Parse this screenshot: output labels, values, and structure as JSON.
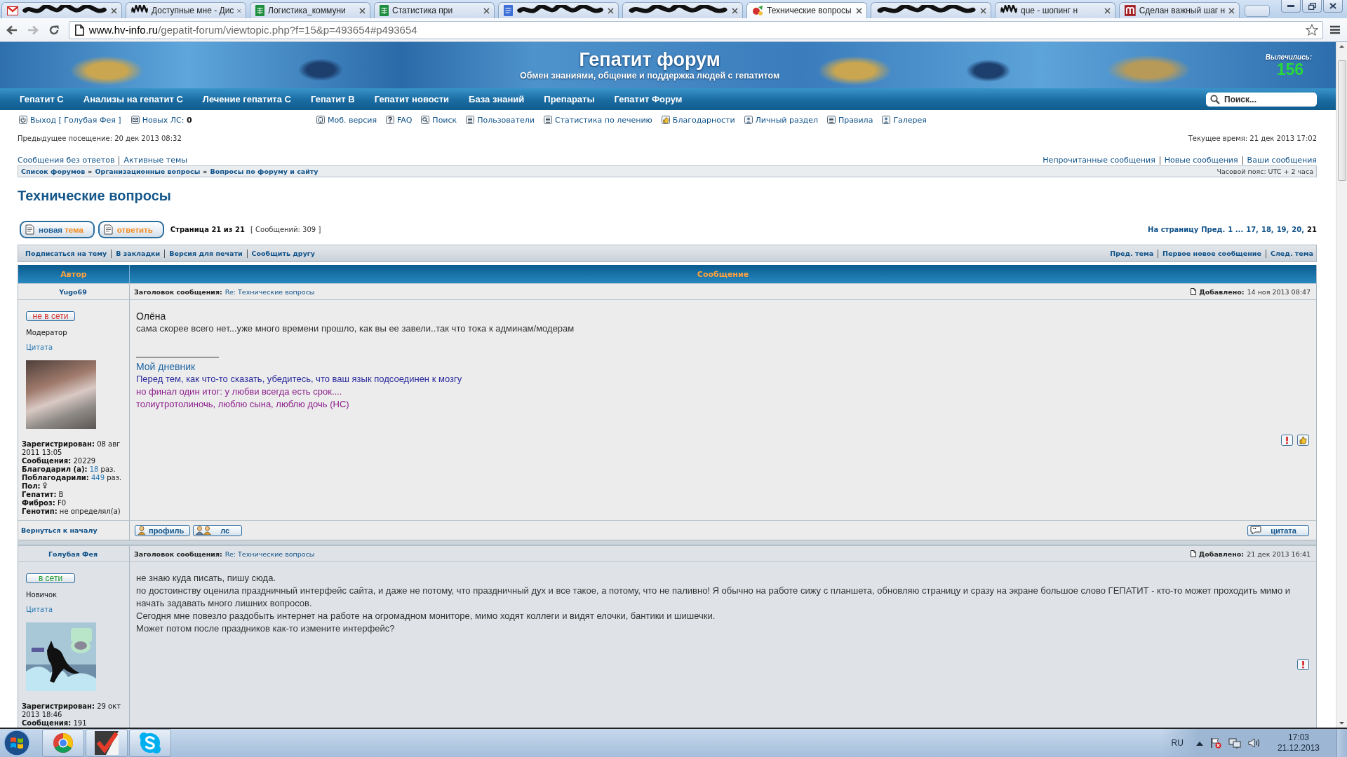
{
  "browser": {
    "tabs": [
      {
        "kind": "mail",
        "redacted": true,
        "selected": false
      },
      {
        "kind": "none",
        "redacted": true,
        "title": "Доступные мне - Дис",
        "selected": false
      },
      {
        "kind": "sheet",
        "redacted": false,
        "title": "Логистика_коммуни",
        "selected": false
      },
      {
        "kind": "sheet",
        "redacted": false,
        "title": "Статистика при",
        "selected": false
      },
      {
        "kind": "doc",
        "redacted": true,
        "selected": false
      },
      {
        "kind": "none",
        "redacted": true,
        "selected": false
      },
      {
        "kind": "forum",
        "redacted": false,
        "title": "Технические вопросы",
        "selected": true
      },
      {
        "kind": "none",
        "redacted": true,
        "selected": false
      },
      {
        "kind": "none",
        "redacted": true,
        "title": "que - шопинг н",
        "selected": false
      },
      {
        "kind": "news",
        "redacted": false,
        "title": "Сделан важный шаг н",
        "selected": false
      }
    ],
    "address": {
      "host": "www.hv-info.ru",
      "path": "/gepatit-forum/viewtopic.php?f=15&p=493654#p493654"
    }
  },
  "banner": {
    "title": "Гепатит форум",
    "subtitle": "Обмен знаниями, общение и поддержка людей с гепатитом",
    "counter_label": "Вылечились:",
    "counter": "156"
  },
  "nav": {
    "items": [
      "Гепатит C",
      "Анализы на гепатит C",
      "Лечение гепатита C",
      "Гепатит B",
      "Гепатит новости",
      "База знаний",
      "Препараты",
      "Гепатит Форум"
    ],
    "search": {
      "placeholder": "Поиск..."
    }
  },
  "user_bar": {
    "left": [
      {
        "kind": "exit",
        "text": "Выход [ Голубая Фея ]"
      },
      {
        "kind": "mail",
        "text": "Новых ЛС: **0**"
      }
    ],
    "right": [
      {
        "kind": "mobile",
        "text": "Моб. версия"
      },
      {
        "kind": "faq",
        "text": "FAQ"
      },
      {
        "kind": "search",
        "text": "Поиск"
      },
      {
        "kind": "list",
        "text": "Пользователи"
      },
      {
        "kind": "list",
        "text": "Статистика по лечению"
      },
      {
        "kind": "thanks",
        "text": "Благодарности"
      },
      {
        "kind": "user",
        "text": "Личный раздел"
      },
      {
        "kind": "list",
        "text": "Правила"
      },
      {
        "kind": "user",
        "text": "Галерея"
      }
    ]
  },
  "visit": {
    "previous": "Предыдущее посещение: 20 дек 2013 08:32",
    "current": "Текущее время: 21 дек 2013 17:02"
  },
  "quick_links": {
    "left": [
      "Сообщения без ответов",
      "Активные темы"
    ],
    "right": [
      "Непрочитанные сообщения",
      "Новые сообщения",
      "Ваши сообщения"
    ]
  },
  "breadcrumbs": {
    "items": [
      {
        "kind": "link",
        "text": "Список форумов"
      },
      {
        "kind": "sep",
        "text": "»"
      },
      {
        "kind": "link",
        "text": "Организационные вопросы"
      },
      {
        "kind": "sep",
        "text": "»"
      },
      {
        "kind": "link",
        "text": "Вопросы по форуму и сайту"
      }
    ],
    "timezone": "Часовой пояс: UTC + 2 часа"
  },
  "topic": {
    "title": "Технические вопросы",
    "buttons": [
      {
        "parts": [
          {
            "text": "новая",
            "accent": false
          },
          {
            "text": "тема",
            "accent": true
          }
        ]
      },
      {
        "parts": [
          {
            "text": "ответить",
            "accent": true
          }
        ]
      }
    ],
    "page_info": "Страница 21 из 21",
    "post_count": "[ Сообщений: 309 ]",
    "pagination": {
      "label": "На страницу",
      "prev": "Пред.",
      "pages": [
        {
          "text": "1 ...",
          "selected": false
        },
        {
          "text": "17,",
          "selected": false
        },
        {
          "text": "18,",
          "selected": false
        },
        {
          "text": "19,",
          "selected": false
        },
        {
          "text": "20,",
          "selected": false
        },
        {
          "text": "21",
          "selected": true
        }
      ]
    }
  },
  "topic_actions": {
    "left": [
      "Подписаться на тему",
      "В закладки",
      "Версия для печати",
      "Сообщить другу"
    ],
    "right": [
      "Пред. тема",
      "Первое новое сообщение",
      "След. тема"
    ]
  },
  "posts_table": {
    "columns": [
      "Автор",
      "Сообщение"
    ],
    "posts": [
      {
        "author": "Yugo69",
        "subject_label": "Заголовок сообщения:",
        "subject": "Re: Технические вопросы",
        "added_label": "Добавлено:",
        "added": "14 ноя 2013 08:47",
        "status": "не в сети",
        "online": false,
        "rank": "Модератор",
        "quote_link": "Цитата",
        "avatar": {
          "kind": "photo"
        },
        "profile": [
          {
            "kind": "text",
            "label": "Зарегистрирован:",
            "value": "08 авг 2011 13:05",
            "link": false
          },
          {
            "kind": "text",
            "label": "Сообщения:",
            "value": "20229",
            "link": false
          },
          {
            "kind": "text",
            "label": "Благодарил (а):",
            "value": "18",
            "suffix": "раз.",
            "link": true
          },
          {
            "kind": "text",
            "label": "Поблагодарили:",
            "value": "449",
            "suffix": "раз.",
            "link": true
          },
          {
            "kind": "female",
            "label": "Пол:",
            "link": false
          },
          {
            "kind": "text",
            "label": "Гепатит:",
            "value": "B",
            "link": false
          },
          {
            "kind": "text",
            "label": "Фиброз:",
            "value": "F0",
            "link": false
          },
          {
            "kind": "text",
            "label": "Генотип:",
            "value": "не определял(а)",
            "link": false
          }
        ],
        "body": [
          {
            "kind": "greeting",
            "text": "Олёна"
          },
          {
            "kind": "text",
            "text": "сама скорее всего нет...уже много времени прошло, как вы ее завели..так что тока к админам/модерам"
          }
        ],
        "signature": [
          {
            "kind": "link",
            "text": "Мой дневник",
            "color": "#1f66a3"
          },
          {
            "kind": "text",
            "text": "Перед тем, как что-то сказать, убедитесь, что ваш язык подсоединен к мозгу",
            "color": "#2c2c9e"
          },
          {
            "kind": "text",
            "text": "но финал один итог: у любви всегда есть срок....",
            "color": "#8e218e"
          },
          {
            "kind": "text",
            "text": "толиутротолиночь, люблю сына, люблю дочь (НС)",
            "color": "#8e218e"
          }
        ],
        "can_thank": true,
        "footer": {
          "back_to_top": "Вернуться к началу",
          "buttons": [
            {
              "kind": "profile",
              "label": "профиль"
            },
            {
              "kind": "pm",
              "label": "лс"
            }
          ],
          "quote": "цитата"
        }
      },
      {
        "author": "Голубая Фея",
        "subject_label": "Заголовок сообщения:",
        "subject": "Re: Технические вопросы",
        "added_label": "Добавлено:",
        "added": "21 дек 2013 16:41",
        "status": "в сети",
        "online": true,
        "rank": "Новичок",
        "quote_link": "Цитата",
        "avatar": {
          "kind": "cartoon"
        },
        "profile": [
          {
            "kind": "text",
            "label": "Зарегистрирован:",
            "value": "29 окт 2013 18:46",
            "link": false
          },
          {
            "kind": "text",
            "label": "Сообщения:",
            "value": "191",
            "link": false
          }
        ],
        "body": [
          {
            "kind": "text",
            "text": "не знаю куда писать, пишу сюда."
          },
          {
            "kind": "text",
            "text": "по достоинству оценила праздничный интерфейс сайта, и даже не потому, что праздничный дух и все такое, а потому, что не паливно! Я обычно на работе сижу с планшета, обновляю страницу и сразу на экране большое слово ГЕПАТИТ - кто-то может проходить мимо и начать задавать много лишних вопросов."
          },
          {
            "kind": "text",
            "text": "Сегодня мне повезло раздобыть интернет на работе на огромадном мониторе, мимо ходят коллеги и видят елочки, бантики и шишечки."
          },
          {
            "kind": "text",
            "text": "Может потом после праздников как-то измените интерфейс?"
          }
        ],
        "can_thank": false
      }
    ]
  },
  "taskbar": {
    "apps": [
      {
        "kind": "browser"
      },
      {
        "kind": "tasks"
      },
      {
        "kind": "chat"
      }
    ],
    "language": "RU",
    "time": "17:03",
    "date": "21.12.2013"
  }
}
